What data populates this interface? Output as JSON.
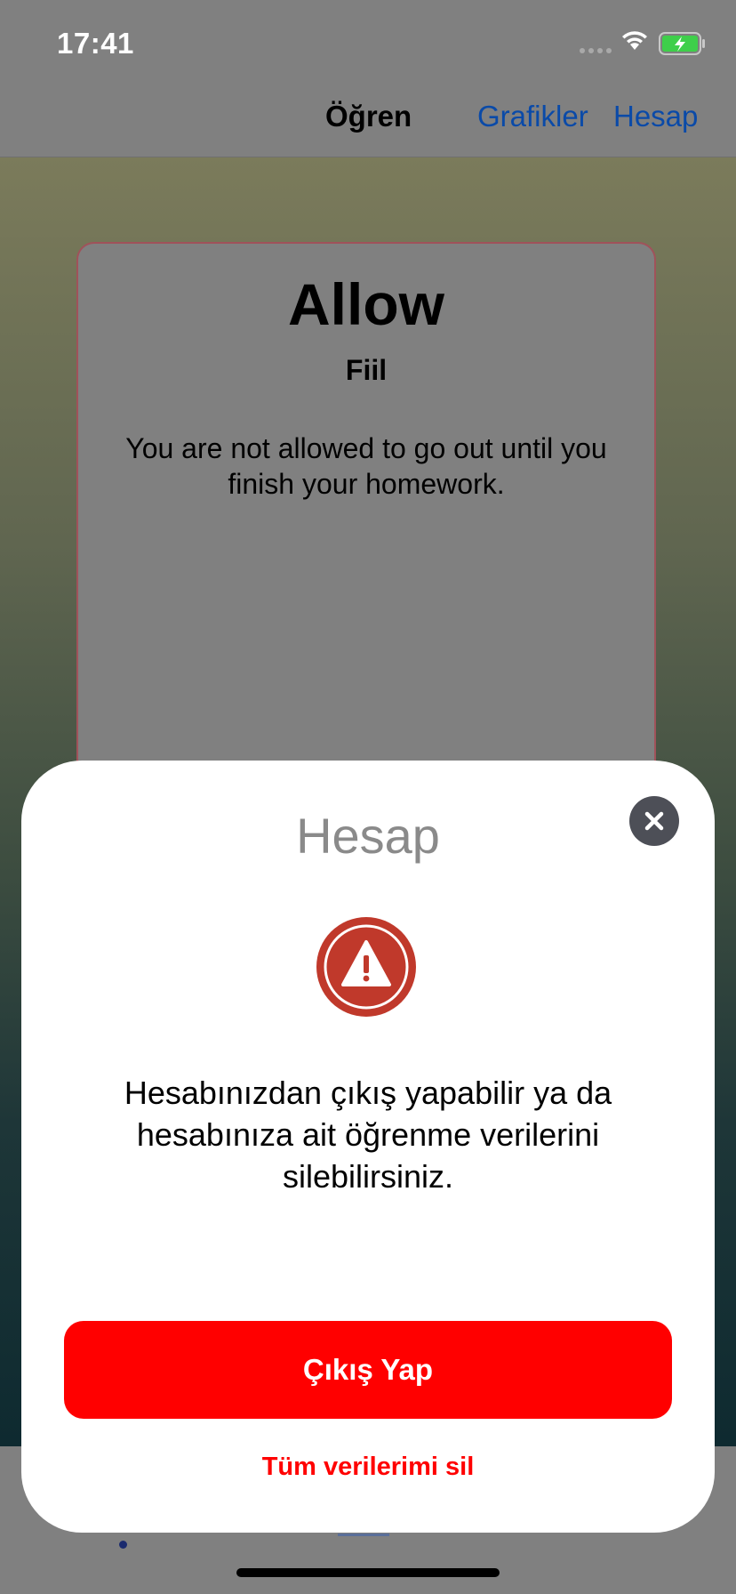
{
  "status_bar": {
    "time": "17:41"
  },
  "nav": {
    "title": "Öğren",
    "links": [
      "Grafikler",
      "Hesap"
    ]
  },
  "card": {
    "word": "Allow",
    "type": "Fiil",
    "example": "You are not allowed to go out until you finish your homework."
  },
  "sheet": {
    "title": "Hesap",
    "message": "Hesabınızdan çıkış yapabilir ya da hesabınıza ait öğrenme verilerini silebilirsiniz.",
    "logout_label": "Çıkış Yap",
    "delete_label": "Tüm verilerimi sil"
  },
  "colors": {
    "accent_blue": "#0a4aa8",
    "danger_red": "#ff0000",
    "warning_icon_red": "#c0392b"
  },
  "icons": [
    "wifi-icon",
    "battery-charging-icon",
    "close-icon",
    "warning-icon"
  ]
}
